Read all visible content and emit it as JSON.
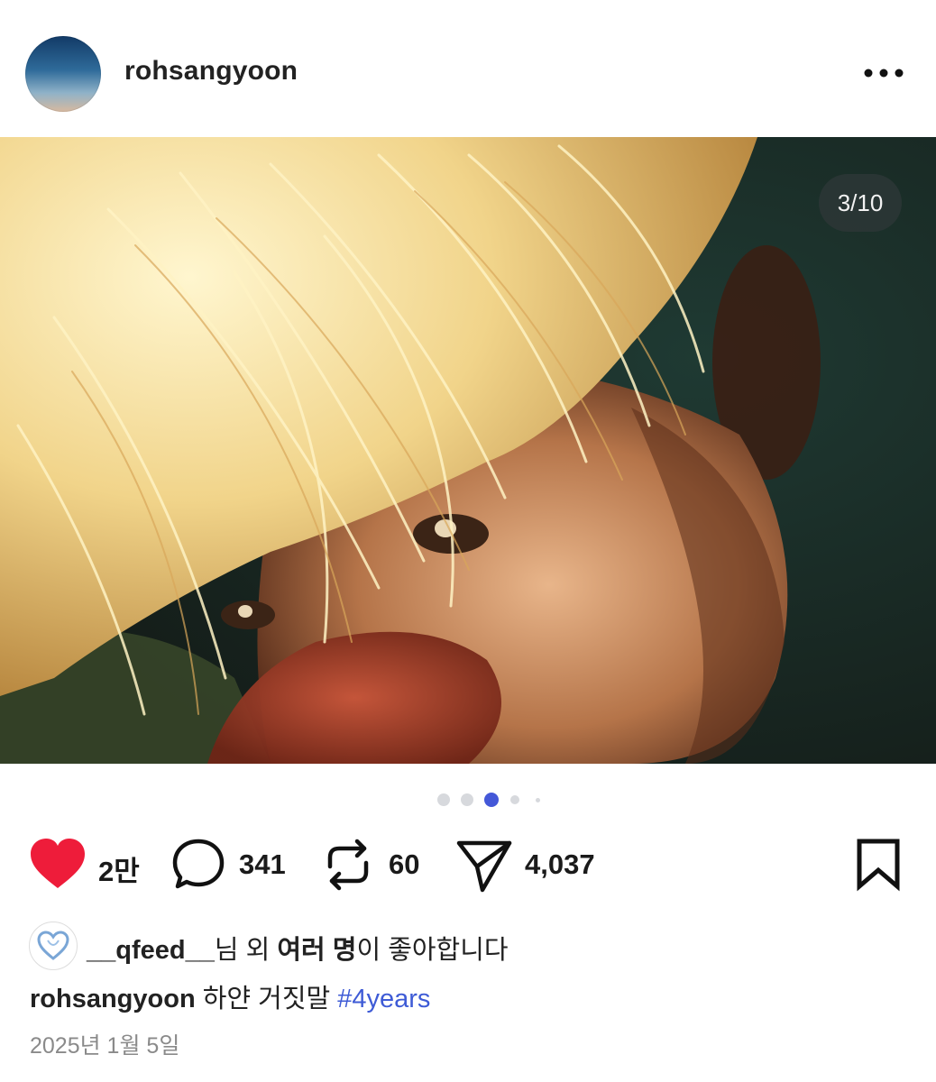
{
  "post": {
    "username": "rohsangyoon",
    "image_counter": "3/10",
    "carousel": {
      "total_dots": 5,
      "active_index": 2
    }
  },
  "actions": {
    "likes": "2만",
    "comments": "341",
    "reposts": "60",
    "shares": "4,037"
  },
  "liked_by": {
    "user": "__qfeed__",
    "suffix_1": "님 외 ",
    "bold": "여러 명",
    "suffix_2": "이 좋아합니다"
  },
  "caption": {
    "username": "rohsangyoon",
    "text": "하얀 거짓말",
    "hashtag": "#4years"
  },
  "date": "2025년 1월 5일",
  "icons": {
    "avatar": "profile-avatar",
    "more": "more-horizontal-icon",
    "like": "heart-icon",
    "comment": "comment-bubble-icon",
    "repost": "repost-icon",
    "share": "share-send-icon",
    "save": "bookmark-icon"
  },
  "colors": {
    "like_red": "#ee1c3a",
    "hashtag_blue": "#3e5bd6",
    "active_dot": "#4458d8",
    "inactive_dot": "#d7d9dd"
  }
}
